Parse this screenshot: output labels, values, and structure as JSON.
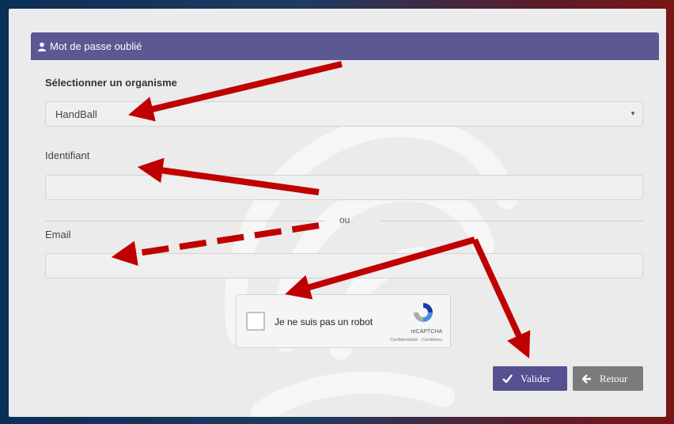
{
  "panel": {
    "title": "Mot de passe oublié"
  },
  "organisme": {
    "label": "Sélectionner un organisme",
    "selected": "HandBall"
  },
  "identifiant": {
    "label": "Identifiant",
    "value": ""
  },
  "separator": {
    "text": "ou"
  },
  "email": {
    "label": "Email",
    "value": ""
  },
  "recaptcha": {
    "checkbox_label": "Je ne suis pas un robot",
    "brand": "reCAPTCHA",
    "terms": "Confidentialité - Conditions"
  },
  "buttons": {
    "valider": "Valider",
    "retour": "Retour"
  },
  "colors": {
    "header": "#5b5893",
    "valider": "#55508f",
    "retour": "#7b7b7b",
    "annotation": "#c00000"
  }
}
